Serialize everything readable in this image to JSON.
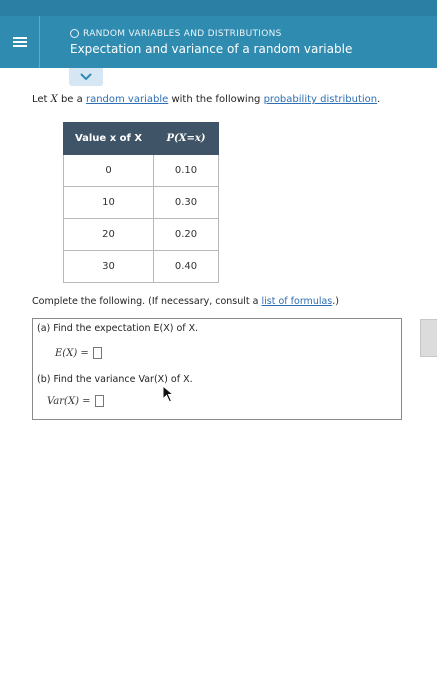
{
  "header": {
    "breadcrumb": "RANDOM VARIABLES AND DISTRIBUTIONS",
    "title": "Expectation and variance of a random variable"
  },
  "collapse_icon": "chevron-down-icon",
  "intro": {
    "prefix": "Let ",
    "var": "X",
    "middle": " be a ",
    "link1": "random variable",
    "mid2": " with the following ",
    "link2": "probability distribution",
    "suffix": "."
  },
  "table": {
    "headers": [
      "Value x of X",
      "P(X=x)"
    ],
    "rows": [
      [
        "0",
        "0.10"
      ],
      [
        "10",
        "0.30"
      ],
      [
        "20",
        "0.20"
      ],
      [
        "30",
        "0.40"
      ]
    ]
  },
  "instructions": {
    "text": "Complete the following. (If necessary, consult a ",
    "link": "list of formulas",
    "suffix": ".)"
  },
  "questions": {
    "a_label": "(a) Find the expectation E(X) of X.",
    "a_expr": "E(X) =",
    "b_label": "(b) Find the variance Var(X) of X.",
    "b_expr": "Var(X) ="
  },
  "colors": {
    "header_bg": "#2f8cb0",
    "table_header_bg": "#3f5467",
    "link": "#2d6fb3"
  }
}
